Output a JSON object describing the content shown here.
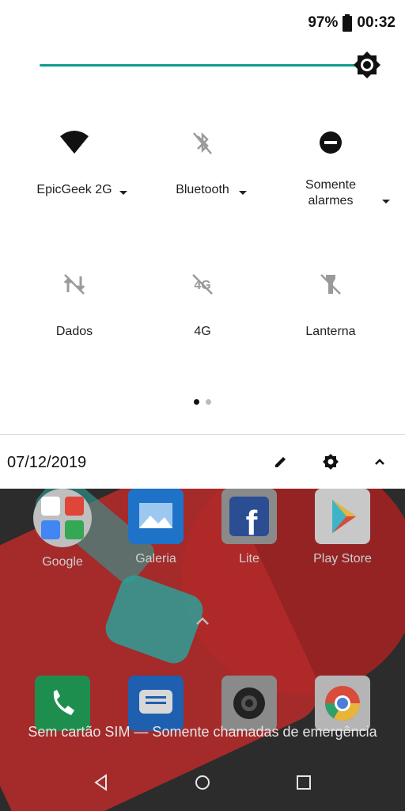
{
  "status_bar": {
    "battery_percent": "97%",
    "time": "00:32"
  },
  "brightness": {
    "level": 0.93,
    "accent": "#0f9d8c"
  },
  "quick_settings": {
    "tiles": [
      {
        "label": "EpicGeek 2G",
        "icon": "wifi-icon",
        "active": true,
        "has_menu": true
      },
      {
        "label": "Bluetooth",
        "icon": "bluetooth-off-icon",
        "active": false,
        "has_menu": true
      },
      {
        "label": "Somente\nalarmes",
        "icon": "do-not-disturb-icon",
        "active": true,
        "has_menu": true
      },
      {
        "label": "Dados",
        "icon": "mobile-data-off-icon",
        "active": false,
        "has_menu": false
      },
      {
        "label": "4G",
        "icon": "4g-off-icon",
        "active": false,
        "has_menu": false
      },
      {
        "label": "Lanterna",
        "icon": "flashlight-off-icon",
        "active": false,
        "has_menu": false
      }
    ],
    "page_indicator": {
      "current": 1,
      "total": 2
    }
  },
  "footer": {
    "date": "07/12/2019"
  },
  "home_apps": {
    "row1": [
      {
        "name": "Google",
        "icon": "google-folder-icon"
      },
      {
        "name": "Galeria",
        "icon": "gallery-icon"
      },
      {
        "name": "Lite",
        "icon": "facebook-lite-icon"
      },
      {
        "name": "Play Store",
        "icon": "play-store-icon"
      }
    ],
    "dock": [
      {
        "icon": "phone-icon"
      },
      {
        "icon": "messages-icon"
      },
      {
        "icon": "camera-icon"
      },
      {
        "icon": "chrome-icon"
      }
    ]
  },
  "lock_message": "Sem cartão SIM — Somente chamadas de emergência"
}
